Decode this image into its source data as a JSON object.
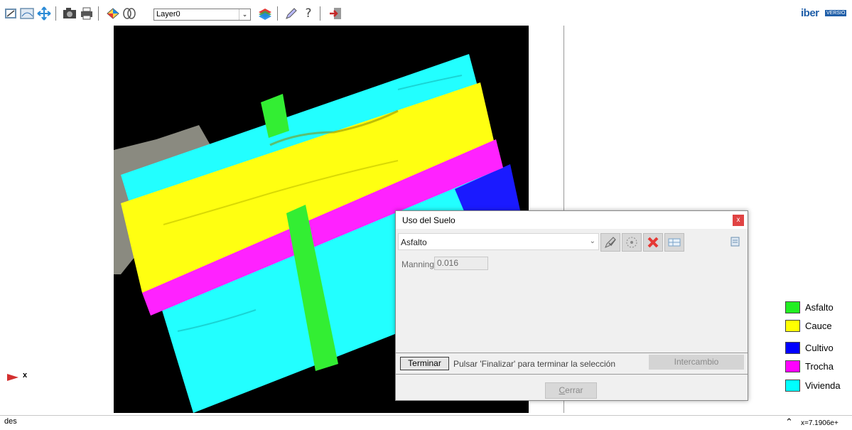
{
  "toolbar": {
    "icons": [
      "zoom-icon",
      "zoom-frame-icon",
      "pan-icon",
      "camera-icon",
      "print-icon",
      "layers-color-icon",
      "view-icon",
      "layer-manager-icon",
      "edit-icon",
      "help-icon",
      "exit-icon"
    ],
    "layer_value": "Layer0"
  },
  "logo": {
    "text": "iber",
    "version": "VERSIO"
  },
  "axis": {
    "label": "x"
  },
  "legend": {
    "items": [
      {
        "label": "Asfalto",
        "color": "#22ee22"
      },
      {
        "label": "Cauce",
        "color": "#ffff00"
      },
      {
        "label": "Cultivo",
        "color": "#0000ff"
      },
      {
        "label": "Trocha",
        "color": "#ff00ff"
      },
      {
        "label": "Vivienda",
        "color": "#00ffff"
      }
    ]
  },
  "dialog": {
    "title": "Uso del Suelo",
    "close_label": "x",
    "combo_value": "Asfalto",
    "manning_label": "Manning",
    "manning_value": "0.016",
    "terminar_label": "Terminar",
    "status_text": "Pulsar 'Finalizar' para terminar la selección",
    "intercambio_label": "Intercambio",
    "cerrar_first": "C",
    "cerrar_rest": "errar"
  },
  "command_line": {
    "text": "des",
    "coords": "x=7.1906e+"
  },
  "colors": {
    "asfalto": "#22ee22",
    "cauce": "#ffff00",
    "cultivo": "#0000ff",
    "trocha": "#ff00ff",
    "vivienda": "#00ffff",
    "background_raster": "#000000"
  }
}
